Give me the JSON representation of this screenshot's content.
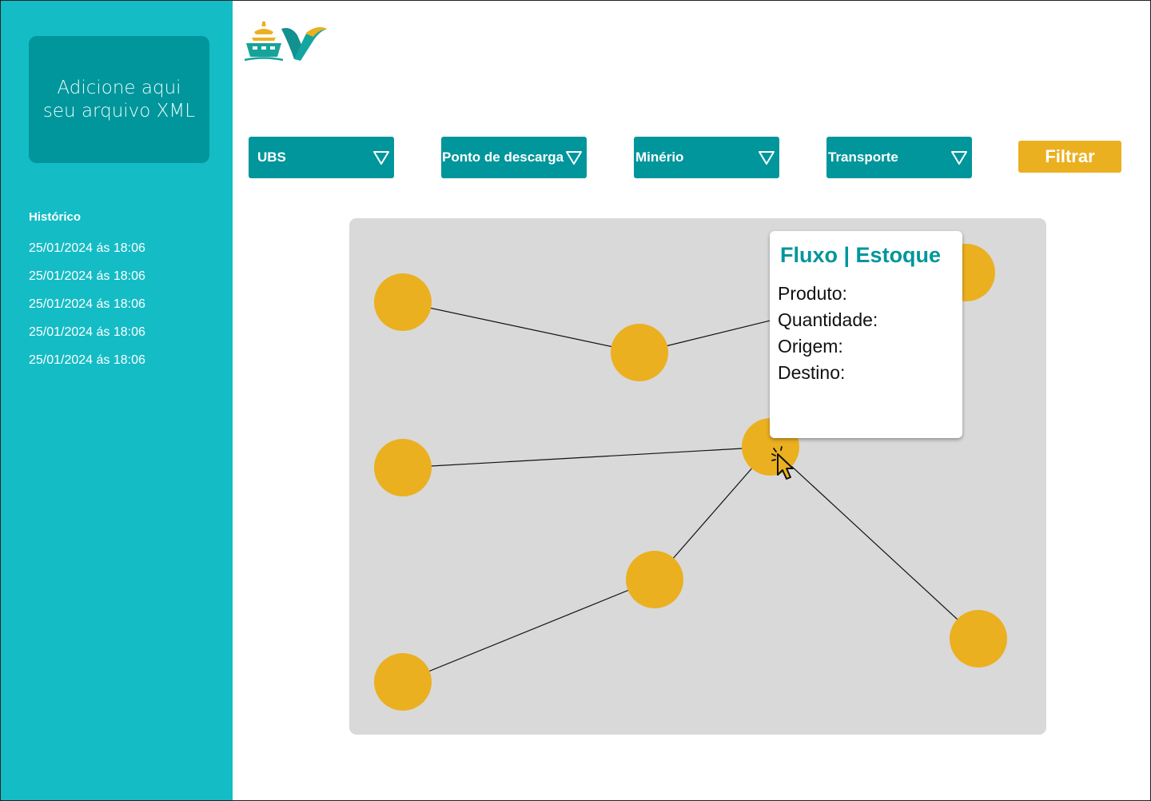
{
  "sidebar": {
    "upload_label": "Adicione aqui seu arquivo XML",
    "history_title": "Histórico",
    "history_items": [
      "25/01/2024 ás 18:06",
      "25/01/2024 ás 18:06",
      "25/01/2024 ás 18:06",
      "25/01/2024 ás 18:06",
      "25/01/2024 ás 18:06"
    ]
  },
  "filters": {
    "dropdowns": [
      "UBS",
      "Ponto de descarga",
      "Minério",
      "Transporte"
    ],
    "filter_button": "Filtrar"
  },
  "graph": {
    "node_count": 8,
    "edge_count": 6
  },
  "tooltip": {
    "title": "Fluxo | Estoque",
    "fields": [
      "Produto:",
      "Quantidade:",
      "Origem:",
      "Destino:"
    ]
  },
  "colors": {
    "sidebar": "#14bcc5",
    "primary": "#00969b",
    "accent": "#ebb020",
    "panel": "#d9d9d9"
  },
  "icons": {
    "logo": "ship-and-v-logo",
    "dropdown": "triangle-down-icon",
    "cursor": "click-cursor-icon"
  }
}
